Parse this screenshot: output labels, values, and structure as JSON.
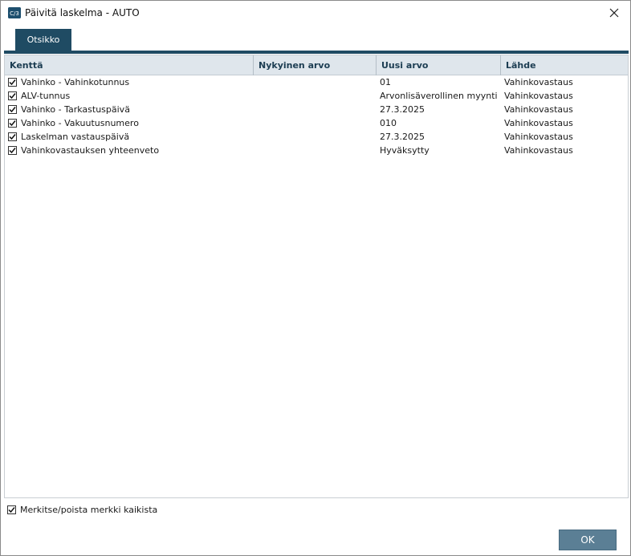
{
  "window": {
    "title": "Päivitä laskelma - AUTO",
    "app_icon": "app-logo-icon",
    "close_icon": "close-icon"
  },
  "tabs": [
    {
      "label": "Otsikko",
      "active": true
    }
  ],
  "table": {
    "columns": [
      "Kenttä",
      "Nykyinen arvo",
      "Uusi arvo",
      "Lähde"
    ],
    "rows": [
      {
        "checked": true,
        "field": "Vahinko - Vahinkotunnus",
        "current": "",
        "new": "01",
        "source": "Vahinkovastaus"
      },
      {
        "checked": true,
        "field": "ALV-tunnus",
        "current": "",
        "new": "Arvonlisäverollinen myynti",
        "source": "Vahinkovastaus"
      },
      {
        "checked": true,
        "field": "Vahinko - Tarkastuspäivä",
        "current": "",
        "new": "27.3.2025",
        "source": "Vahinkovastaus"
      },
      {
        "checked": true,
        "field": "Vahinko - Vakuutusnumero",
        "current": "",
        "new": "010",
        "source": "Vahinkovastaus"
      },
      {
        "checked": true,
        "field": "Laskelman vastauspäivä",
        "current": "",
        "new": "27.3.2025",
        "source": "Vahinkovastaus"
      },
      {
        "checked": true,
        "field": "Vahinkovastauksen yhteenveto",
        "current": "",
        "new": "Hyväksytty",
        "source": "Vahinkovastaus"
      }
    ]
  },
  "footer": {
    "select_all_label": "Merkitse/poista merkki kaikista",
    "select_all_checked": true,
    "ok_label": "OK"
  },
  "colors": {
    "accent": "#1f4b63",
    "header_bg": "#dfe6ec",
    "ok_button": "#5b7f95"
  }
}
